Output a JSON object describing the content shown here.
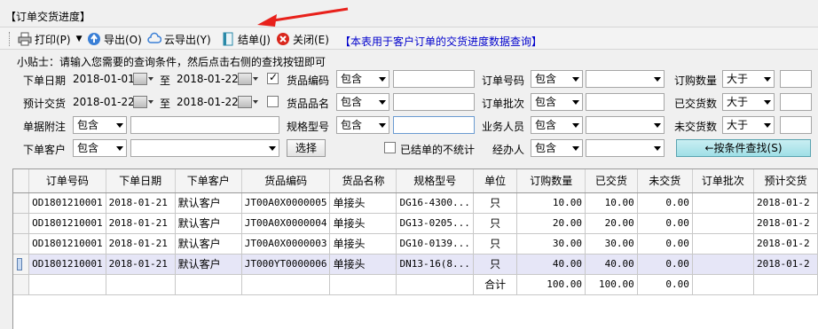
{
  "window": {
    "title": "【订单交货进度】"
  },
  "toolbar": {
    "print": "打印(P)",
    "export": "导出(O)",
    "cloud_export": "云导出(Y)",
    "close_order": "结单(J)",
    "close": "关闭(E)",
    "note": "【本表用于客户订单的交货进度数据查询】"
  },
  "tip": "小贴士：请输入您需要的查询条件，然后点击右侧的查找按钮即可",
  "filters": {
    "order_date_label": "下单日期",
    "order_date_from": "2018-01-01",
    "order_date_to": "2018-01-22",
    "to_label": "至",
    "plan_date_label": "预计交货",
    "plan_date_from": "2018-01-22",
    "plan_date_to": "2018-01-22",
    "remark_label": "单据附注",
    "customer_label": "下单客户",
    "product_code_label": "货品编码",
    "product_name_label": "货品品名",
    "spec_label": "规格型号",
    "select_button": "选择",
    "order_no_label": "订单号码",
    "order_batch_label": "订单批次",
    "salesman_label": "业务人员",
    "handler_label": "经办人",
    "exclude_closed_label": "已结单的不统计",
    "order_qty_label": "订购数量",
    "delivered_label": "已交货数",
    "undelivered_label": "未交货数",
    "contains": "包含",
    "greater": "大于",
    "search_button": "←按条件查找(S)"
  },
  "table": {
    "columns": [
      "订单号码",
      "下单日期",
      "下单客户",
      "货品编码",
      "货品名称",
      "规格型号",
      "单位",
      "订购数量",
      "已交货",
      "未交货",
      "订单批次",
      "预计交货"
    ],
    "rows": [
      [
        "OD1801210001",
        "2018-01-21",
        "默认客户",
        "JT00A0X0000005",
        "单接头",
        "DG16-4300...",
        "只",
        "10.00",
        "10.00",
        "0.00",
        "",
        "2018-01-2"
      ],
      [
        "OD1801210001",
        "2018-01-21",
        "默认客户",
        "JT00A0X0000004",
        "单接头",
        "DG13-0205...",
        "只",
        "20.00",
        "20.00",
        "0.00",
        "",
        "2018-01-2"
      ],
      [
        "OD1801210001",
        "2018-01-21",
        "默认客户",
        "JT00A0X0000003",
        "单接头",
        "DG10-0139...",
        "只",
        "30.00",
        "30.00",
        "0.00",
        "",
        "2018-01-2"
      ],
      [
        "OD1801210001",
        "2018-01-21",
        "默认客户",
        "JT000YT0000006",
        "单接头",
        "DN13-16(8...",
        "只",
        "40.00",
        "40.00",
        "0.00",
        "",
        "2018-01-2"
      ]
    ],
    "total_label": "合计",
    "total_qty": "100.00",
    "total_delivered": "100.00",
    "total_undelivered": "0.00"
  }
}
